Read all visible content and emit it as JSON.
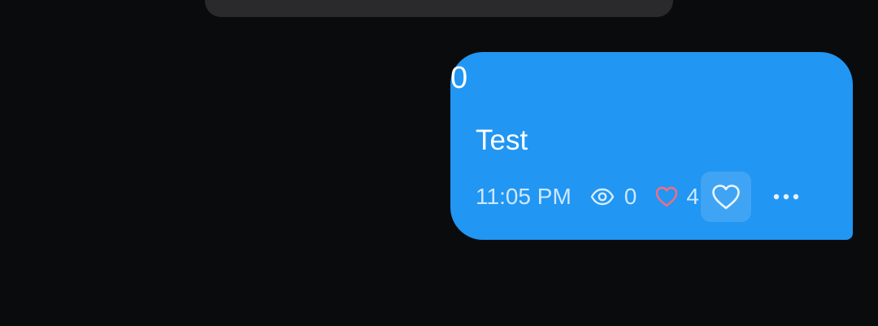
{
  "message": {
    "counter": "0",
    "text": "Test",
    "time": "11:05 PM",
    "views": "0",
    "likes": "4"
  },
  "icons": {
    "views": "eye-icon",
    "likes": "heart-outline-icon",
    "like_button": "heart-outline-icon",
    "more": "more-horizontal-icon"
  },
  "colors": {
    "background": "#0a0b0d",
    "bubble": "#2196f3",
    "like_heart": "#ff6b7d",
    "top_bar": "#2a2a2c"
  }
}
